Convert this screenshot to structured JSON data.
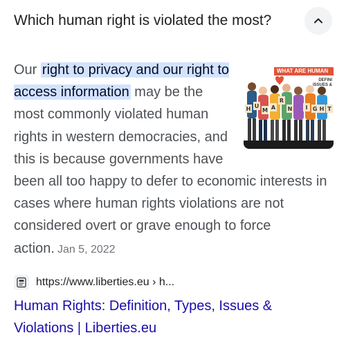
{
  "question": "Which human right is violated the most?",
  "collapse_icon": "chevron-up-icon",
  "answer": {
    "highlight": "right to privacy and our right to access information",
    "before": "Our ",
    "after": " may be the most commonly violated human rights in western democracies, and this is because governments have been all too happy to defer to economic interests in cases where human rights violations are not considered overt or grave enough to force action.",
    "date": "Jan 5, 2022"
  },
  "thumbnail": {
    "banner": "WHAT ARE HUMAN",
    "sub": "DEFINI\nISSUES &",
    "letters": [
      "H",
      "U",
      "M",
      "A",
      "N",
      "R",
      "I",
      "G",
      "H",
      "T"
    ]
  },
  "source": {
    "url": "https://www.liberties.eu › h...",
    "favicon_icon": "document-icon"
  },
  "result_title": "Human Rights: Definition, Types, Issues & Violations | Liberties.eu",
  "colors": {
    "link": "#1a0dab",
    "highlight_bg": "#d3e3fd",
    "body_text": "#4d5156",
    "button_bg": "#f1f3f4"
  }
}
